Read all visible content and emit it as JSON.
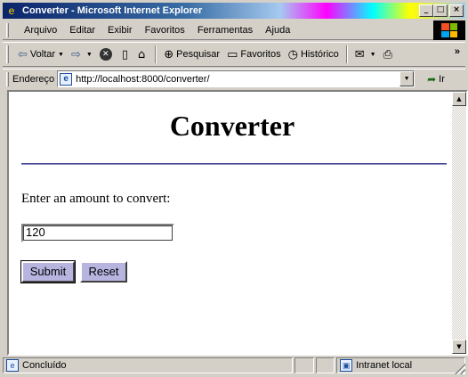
{
  "window": {
    "title": "Converter - Microsoft Internet Explorer",
    "minimize": "_",
    "maximize": "□",
    "close": "×"
  },
  "menu": {
    "items": [
      "Arquivo",
      "Editar",
      "Exibir",
      "Favoritos",
      "Ferramentas",
      "Ajuda"
    ]
  },
  "toolbar": {
    "back": "Voltar",
    "search": "Pesquisar",
    "favorites": "Favoritos",
    "history": "Histórico"
  },
  "address": {
    "label": "Endereço",
    "url": "http://localhost:8000/converter/",
    "go": "Ir"
  },
  "page": {
    "title": "Converter",
    "prompt": "Enter an amount to convert:",
    "amount_value": "120",
    "submit_label": "Submit",
    "reset_label": "Reset"
  },
  "status": {
    "text": "Concluído",
    "zone": "Intranet local"
  }
}
